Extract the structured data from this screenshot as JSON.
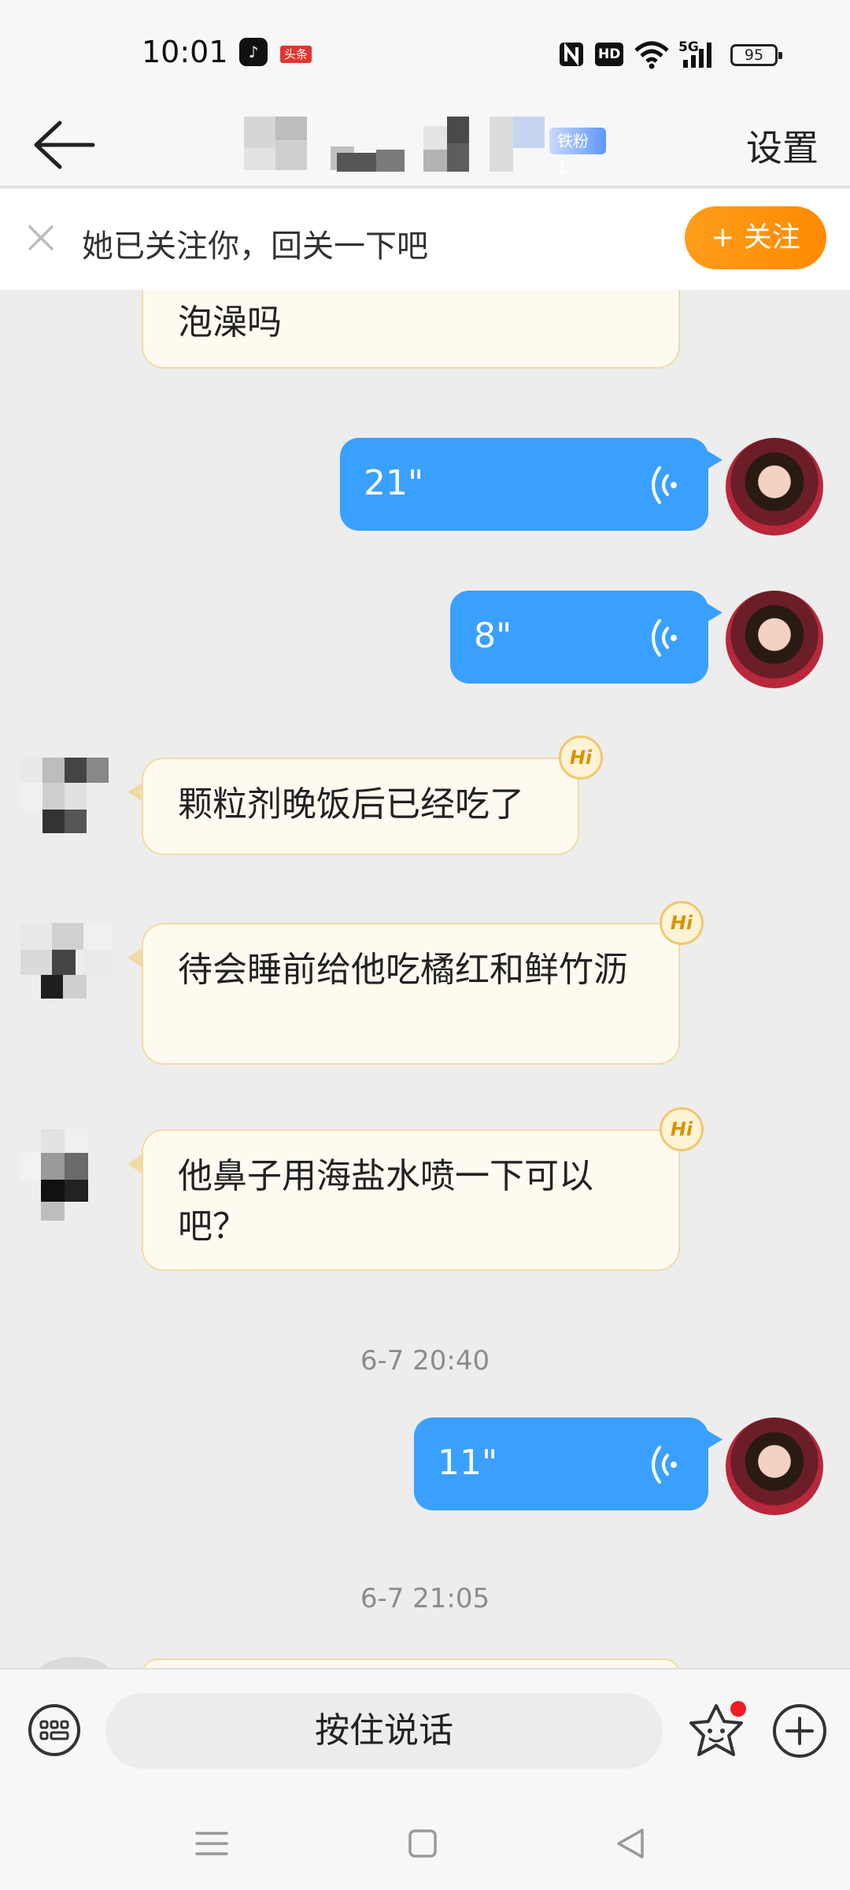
{
  "status_bar": {
    "time": "10:01",
    "toutiao_badge": "头条",
    "network": "5G",
    "hd": "HD",
    "battery": "95"
  },
  "nav": {
    "fan_badge": "铁粉1",
    "settings": "设置"
  },
  "banner": {
    "text": "她已关注你，回关一下吧",
    "follow_label": "+ 关注"
  },
  "messages": [
    {
      "type": "text_in",
      "text": "泡澡吗"
    },
    {
      "type": "voice_out",
      "duration": "21\""
    },
    {
      "type": "voice_out",
      "duration": "8\""
    },
    {
      "type": "text_in",
      "text": "颗粒剂晚饭后已经吃了",
      "hi": "Hi"
    },
    {
      "type": "text_in",
      "text": "待会睡前给他吃橘红和鲜竹沥",
      "hi": "Hi"
    },
    {
      "type": "text_in",
      "text": "他鼻子用海盐水喷一下可以吧？",
      "hi": "Hi"
    },
    {
      "type": "timestamp",
      "text": "6-7 20:40"
    },
    {
      "type": "voice_out",
      "duration": "11\""
    },
    {
      "type": "timestamp",
      "text": "6-7 21:05"
    }
  ],
  "input_bar": {
    "hold_to_talk": "按住说话"
  },
  "colors": {
    "accent_blue": "#3aa0ff",
    "follow_orange": "#ff8a00",
    "incoming_bubble": "#fffaf0"
  }
}
